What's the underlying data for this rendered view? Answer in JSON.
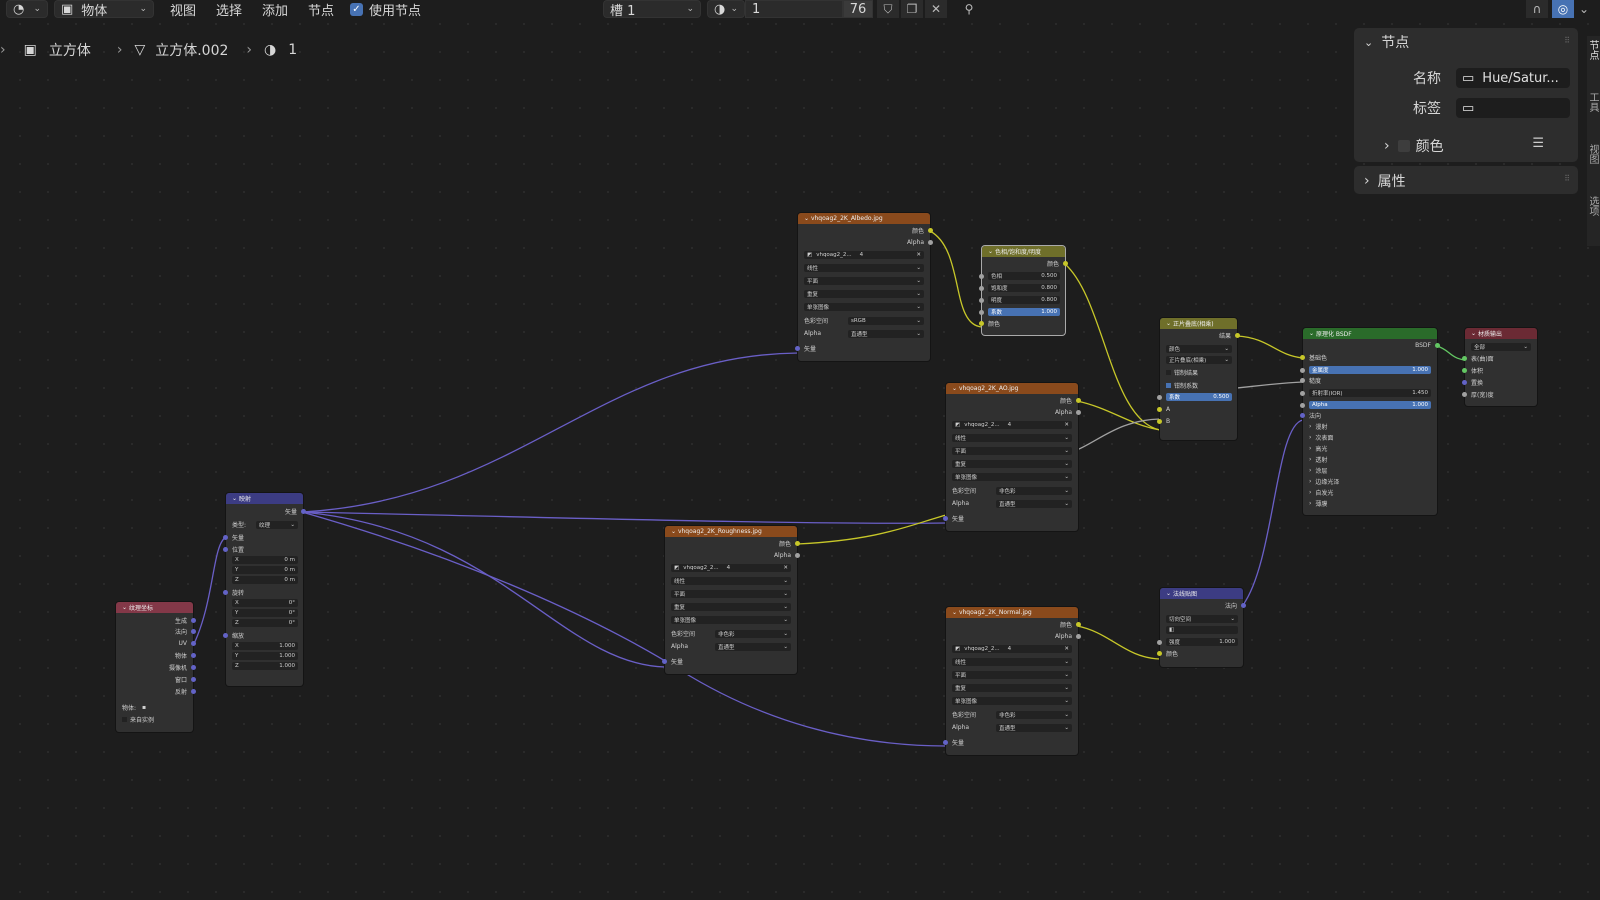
{
  "header": {
    "editor_icon": "node-editor-icon",
    "mode": "物体",
    "menus": [
      "视图",
      "选择",
      "添加",
      "节点"
    ],
    "use_nodes_label": "使用节点",
    "slot": "槽 1",
    "material_name": "1",
    "user_count": "76",
    "icons": [
      "shield-icon",
      "duplicate-icon",
      "close-icon",
      "pin-icon",
      "snap-icon",
      "overlay-icon"
    ]
  },
  "breadcrumb": {
    "object": "立方体",
    "mesh": "立方体.002",
    "material": "1"
  },
  "sidebar": {
    "section_node": "节点",
    "name_label": "名称",
    "name_value": "Hue/Satur...",
    "label_label": "标签",
    "label_value": "",
    "color_label": "颜色",
    "properties_label": "属性",
    "tabs": [
      "节点",
      "工具",
      "视图",
      "选项"
    ]
  },
  "nodes": {
    "texcoord": {
      "title": "纹理坐标",
      "outputs": [
        "生成",
        "法向",
        "UV",
        "物体",
        "摄像机",
        "窗口",
        "反射"
      ],
      "object_label": "物体:",
      "from_instancer": "来自实例"
    },
    "mapping": {
      "title": "映射",
      "output": "矢量",
      "type_label": "类型:",
      "type_value": "纹理",
      "vector_in": "矢量",
      "location": "位置",
      "loc": [
        [
          "X",
          "0 m"
        ],
        [
          "Y",
          "0 m"
        ],
        [
          "Z",
          "0 m"
        ]
      ],
      "rotation": "旋转",
      "rot": [
        [
          "X",
          "0°"
        ],
        [
          "Y",
          "0°"
        ],
        [
          "Z",
          "0°"
        ]
      ],
      "scale": "缩放",
      "scl": [
        [
          "X",
          "1.000"
        ],
        [
          "Y",
          "1.000"
        ],
        [
          "Z",
          "1.000"
        ]
      ]
    },
    "albedo": {
      "title": "vhqoag2_2K_Albedo.jpg",
      "out_color": "颜色",
      "out_alpha": "Alpha",
      "image": "vhqoag2_2...",
      "users": "4",
      "interp": "线性",
      "proj": "平面",
      "ext": "重复",
      "source": "单张图像",
      "cs_label": "色彩空间",
      "cs_value": "sRGB",
      "alpha_label": "Alpha",
      "alpha_value": "直通型",
      "vector": "矢量"
    },
    "ao": {
      "title": "vhqoag2_2K_AO.jpg",
      "out_color": "颜色",
      "out_alpha": "Alpha",
      "image": "vhqoag2_2...",
      "users": "4",
      "interp": "线性",
      "proj": "平面",
      "ext": "重复",
      "source": "单张图像",
      "cs_label": "色彩空间",
      "cs_value": "非色彩",
      "alpha_label": "Alpha",
      "alpha_value": "直通型",
      "vector": "矢量"
    },
    "rough": {
      "title": "vhqoag2_2K_Roughness.jpg",
      "out_color": "颜色",
      "out_alpha": "Alpha",
      "image": "vhqoag2_2...",
      "users": "4",
      "interp": "线性",
      "proj": "平面",
      "ext": "重复",
      "source": "单张图像",
      "cs_label": "色彩空间",
      "cs_value": "非色彩",
      "alpha_label": "Alpha",
      "alpha_value": "直通型",
      "vector": "矢量"
    },
    "normal": {
      "title": "vhqoag2_2K_Normal.jpg",
      "out_color": "颜色",
      "out_alpha": "Alpha",
      "image": "vhqoag2_2...",
      "users": "4",
      "interp": "线性",
      "proj": "平面",
      "ext": "重复",
      "source": "单张图像",
      "cs_label": "色彩空间",
      "cs_value": "非色彩",
      "alpha_label": "Alpha",
      "alpha_value": "直通型",
      "vector": "矢量"
    },
    "huesat": {
      "title": "色相/饱和度/明度",
      "output": "颜色",
      "hue": [
        "色相",
        "0.500"
      ],
      "sat": [
        "饱和度",
        "0.800"
      ],
      "val": [
        "明度",
        "0.800"
      ],
      "fac": [
        "系数",
        "1.000"
      ],
      "color_in": "颜色"
    },
    "mix": {
      "title": "正片叠底(相乘)",
      "output": "结果",
      "type": "颜色",
      "blend": "正片叠底(相乘)",
      "clamp_result": "钳制结果",
      "clamp_factor": "钳制系数",
      "fac": [
        "系数",
        "0.500"
      ],
      "a": "A",
      "b": "B"
    },
    "bsdf": {
      "title": "原理化 BSDF",
      "output": "BSDF",
      "base_color": "基础色",
      "metallic": [
        "金属度",
        "1.000"
      ],
      "roughness": "糙度",
      "ior": [
        "折射率(IOR)",
        "1.450"
      ],
      "alpha": [
        "Alpha",
        "1.000"
      ],
      "normal": "法向",
      "panels": [
        "漫射",
        "次表面",
        "高光",
        "透射",
        "涂层",
        "边缘光泽",
        "自发光",
        "薄膜"
      ]
    },
    "output": {
      "title": "材质输出",
      "target": "全部",
      "surface": "表(曲)面",
      "volume": "体积",
      "displacement": "置换",
      "thickness": "厚(宽)度"
    },
    "normalmap": {
      "title": "法线贴图",
      "output": "法向",
      "space": "切向空间",
      "strength": [
        "强度",
        "1.000"
      ],
      "color_in": "颜色"
    }
  }
}
